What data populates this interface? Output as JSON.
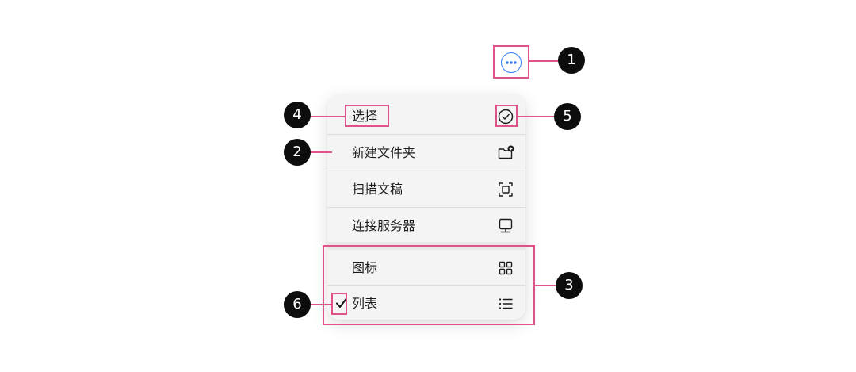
{
  "more_button": {
    "icon": "more-horizontal-circle-icon",
    "color": "#2f7cf6"
  },
  "menu": {
    "items": [
      {
        "label": "选择",
        "icon": "checkmark-circle-icon"
      },
      {
        "label": "新建文件夹",
        "icon": "new-folder-icon"
      },
      {
        "label": "扫描文稿",
        "icon": "scan-document-icon"
      },
      {
        "label": "连接服务器",
        "icon": "connect-server-icon"
      }
    ],
    "view_options": [
      {
        "label": "图标",
        "icon": "grid-icon",
        "checked": false
      },
      {
        "label": "列表",
        "icon": "list-icon",
        "checked": true
      }
    ]
  },
  "callouts": {
    "1": "1",
    "2": "2",
    "3": "3",
    "4": "4",
    "5": "5",
    "6": "6"
  },
  "annotation_color": "#e0538a"
}
